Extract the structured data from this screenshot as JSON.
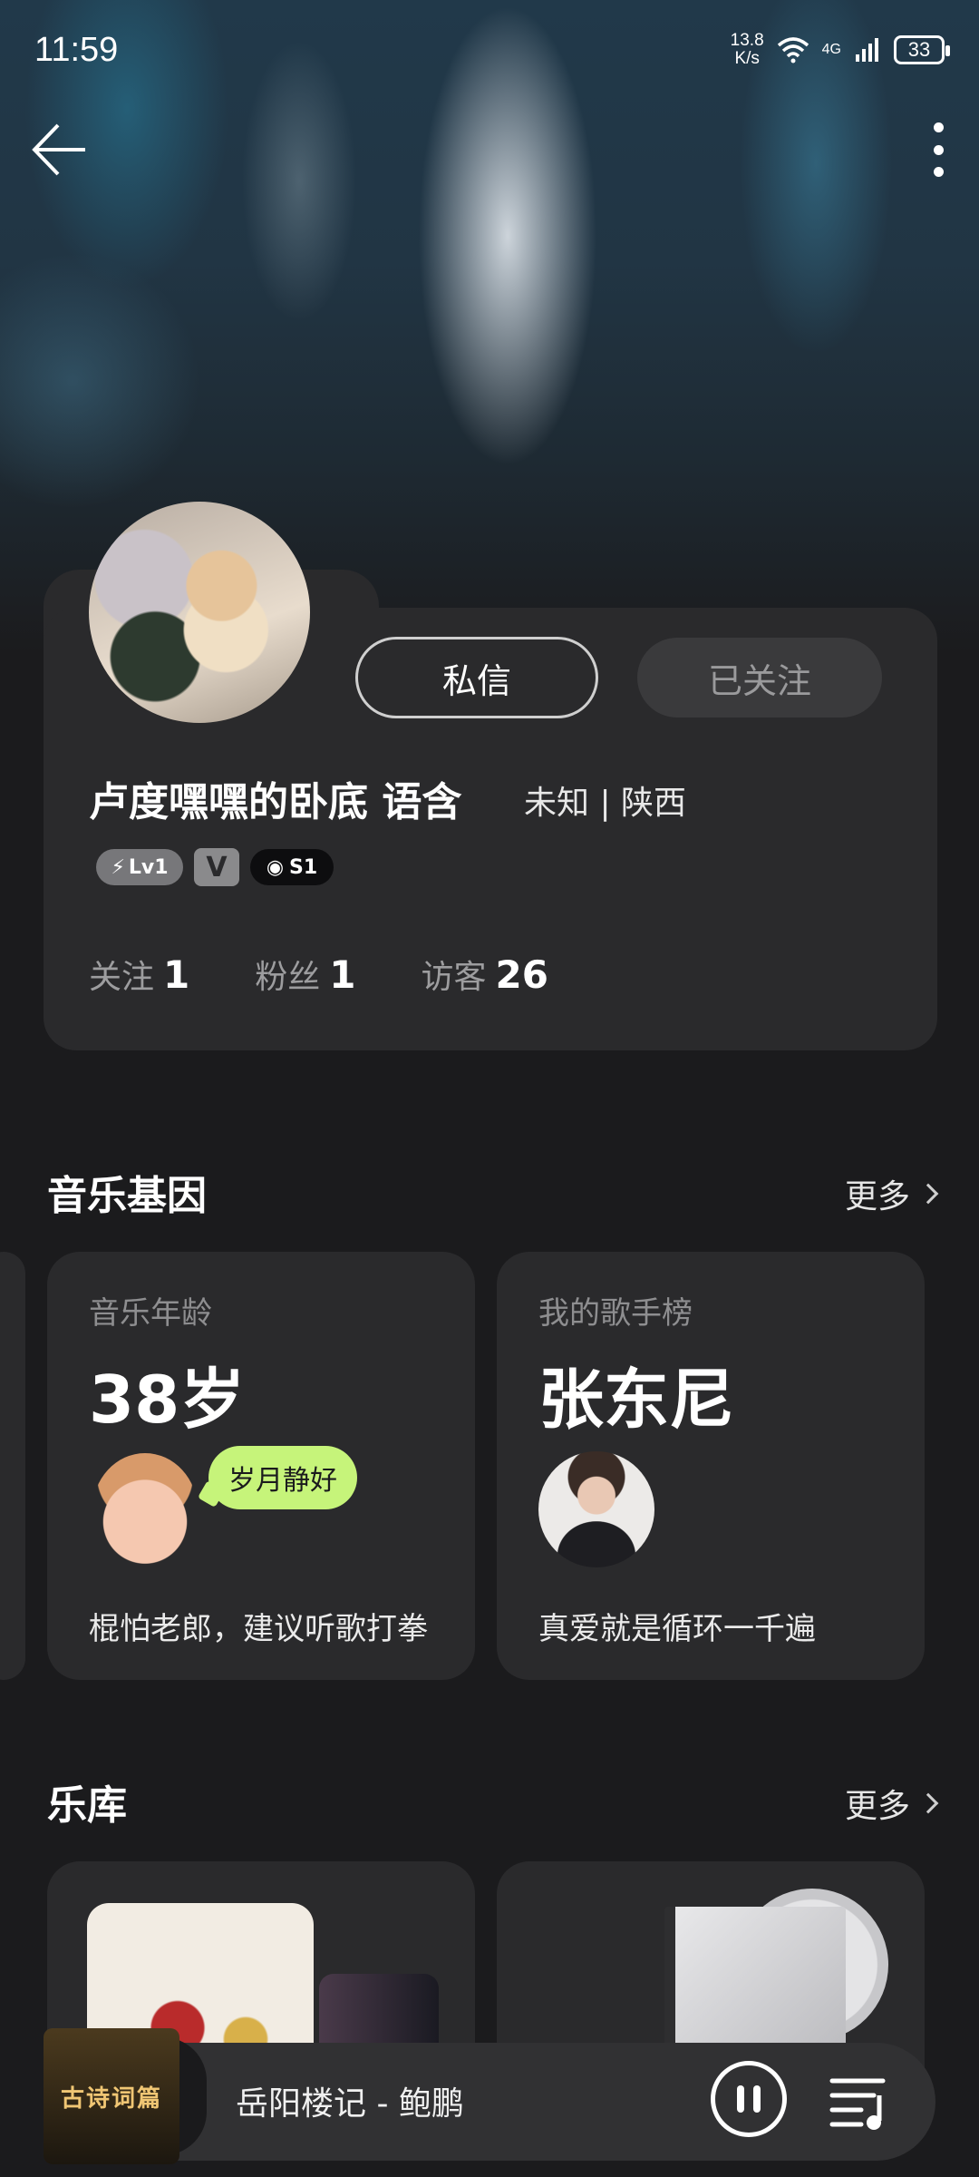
{
  "status_bar": {
    "time": "11:59",
    "net_speed": "13.8\nK/s",
    "net_speed_top": "13.8",
    "net_speed_bottom": "K/s",
    "network": "4G",
    "battery": "33"
  },
  "profile": {
    "name": "卢度嘿嘿的卧底 语含",
    "info": "未知 | 陕西",
    "message_label": "私信",
    "followed_label": "已关注",
    "badges": {
      "level": "Lv1",
      "vip": "V",
      "score": "S1"
    },
    "stats": [
      {
        "label": "关注",
        "value": "1"
      },
      {
        "label": "粉丝",
        "value": "1"
      },
      {
        "label": "访客",
        "value": "26"
      }
    ]
  },
  "music_gene": {
    "title": "音乐基因",
    "more": "更多",
    "cards": [
      {
        "label": "音乐年龄",
        "value": "38岁",
        "bubble": "岁月静好",
        "desc": "棍怕老郎，建议听歌打拳"
      },
      {
        "label": "我的歌手榜",
        "value": "张东尼",
        "desc": "真爱就是循环一千遍"
      }
    ]
  },
  "library": {
    "title": "乐库",
    "more": "更多"
  },
  "player": {
    "cover_text": "古诗词篇",
    "now_playing": "岳阳楼记 - 鲍鹏"
  },
  "icons": {
    "back": "arrow-left-icon",
    "more": "more-vertical-icon",
    "pause": "pause-icon",
    "playlist": "playlist-icon"
  },
  "colors": {
    "background": "#1b1b1d",
    "card": "#2a2a2c",
    "bubble": "#c6f47a"
  }
}
